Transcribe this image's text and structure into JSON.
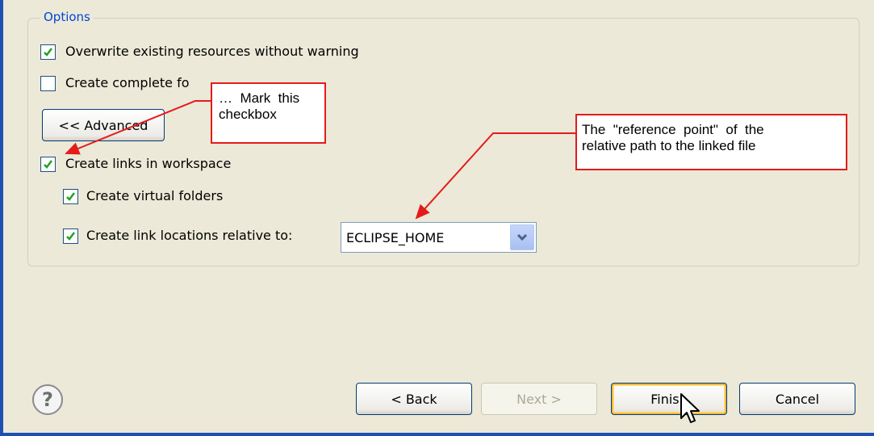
{
  "options": {
    "legend": "Options",
    "overwrite": {
      "label": "Overwrite existing resources without warning",
      "checked": true
    },
    "complete_folder": {
      "label": "Create complete fo",
      "checked": false
    },
    "advanced_button": "<< Advanced",
    "create_links": {
      "label": "Create links in workspace",
      "checked": true
    },
    "virtual_folders": {
      "label": "Create virtual folders",
      "checked": true
    },
    "relative_to": {
      "label": "Create link locations relative to:",
      "checked": true
    },
    "relative_combo": {
      "value": "ECLIPSE_HOME"
    }
  },
  "annotations": {
    "mark_checkbox_line1": "…  Mark  this",
    "mark_checkbox_line2": "checkbox",
    "reference_line1": "The  \"reference  point\"  of  the",
    "reference_line2": "relative path to the linked file",
    "color": "#e41b1b"
  },
  "footer": {
    "back": "< Back",
    "next": "Next >",
    "finish": "Finish",
    "cancel": "Cancel"
  },
  "colors": {
    "dialog_bg": "#ece9d8",
    "legend": "#0046d5",
    "frame": "#1f4fb5",
    "checkbox_tick": "#21a121"
  }
}
